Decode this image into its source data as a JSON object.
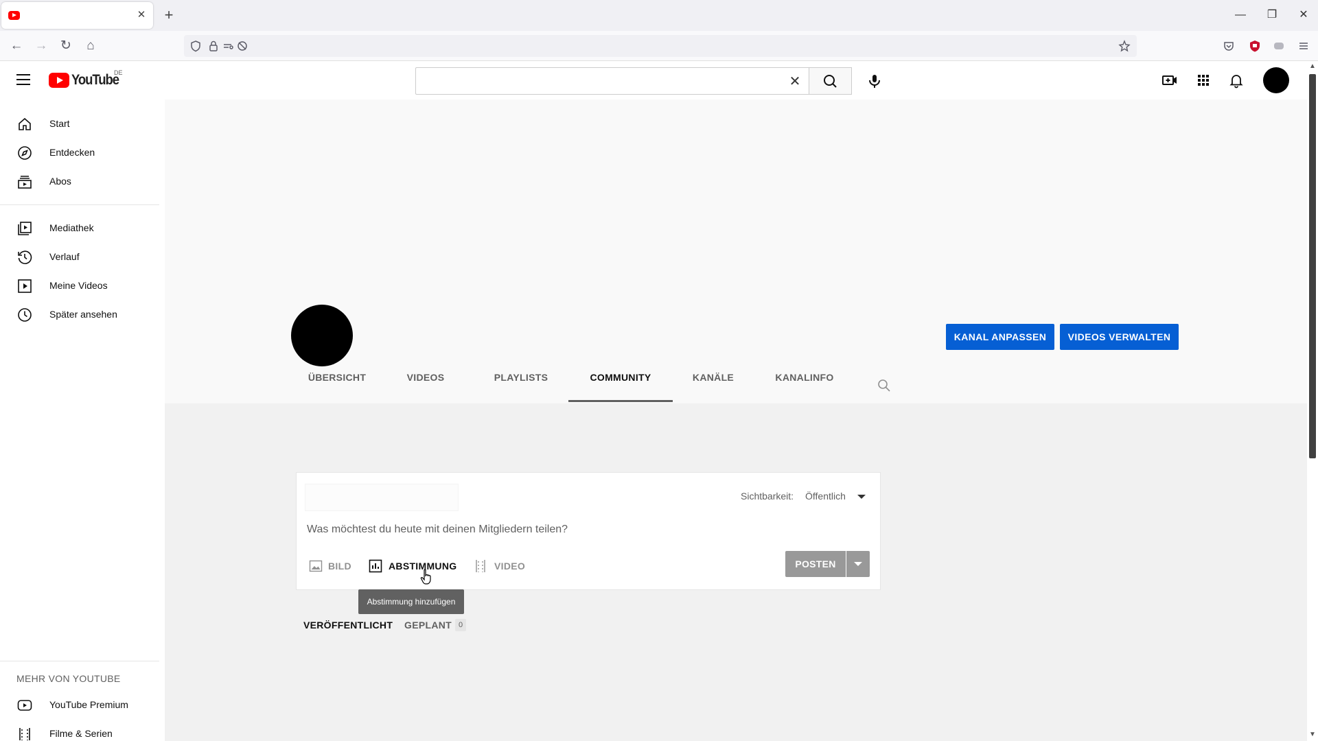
{
  "browser": {
    "tab_title": "",
    "tab_close_glyph": "✕",
    "newtab_glyph": "+",
    "window_controls": {
      "minimize": "—",
      "restore": "❐",
      "close": "✕"
    },
    "nav": {
      "back": "←",
      "forward": "→",
      "reload": "↻",
      "home": "⌂"
    },
    "url_icons": [
      "shield-icon",
      "lock-icon",
      "permissions-icon",
      "tracking-off-icon"
    ]
  },
  "masthead": {
    "logo_text": "YouTube",
    "region_code": "DE",
    "search_placeholder": "",
    "search_value": "",
    "clear_glyph": "✕"
  },
  "sidebar": {
    "primary": [
      {
        "label": "Start",
        "icon": "home-icon"
      },
      {
        "label": "Entdecken",
        "icon": "compass-icon"
      },
      {
        "label": "Abos",
        "icon": "subscriptions-icon"
      }
    ],
    "library": [
      {
        "label": "Mediathek",
        "icon": "library-icon"
      },
      {
        "label": "Verlauf",
        "icon": "history-icon"
      },
      {
        "label": "Meine Videos",
        "icon": "my-videos-icon"
      },
      {
        "label": "Später ansehen",
        "icon": "watch-later-icon"
      }
    ],
    "more_heading": "MEHR VON YOUTUBE",
    "more": [
      {
        "label": "YouTube Premium",
        "icon": "premium-icon"
      },
      {
        "label": "Filme & Serien",
        "icon": "movies-icon"
      }
    ]
  },
  "channel": {
    "customize_button": "KANAL ANPASSEN",
    "manage_button": "VIDEOS VERWALTEN",
    "tabs": [
      "ÜBERSICHT",
      "VIDEOS",
      "PLAYLISTS",
      "COMMUNITY",
      "KANÄLE",
      "KANALINFO"
    ],
    "active_tab": "COMMUNITY"
  },
  "post": {
    "visibility_label": "Sichtbarkeit:",
    "visibility_value": "Öffentlich",
    "prompt": "Was möchtest du heute mit deinen Mitgliedern teilen?",
    "options": {
      "image": "BILD",
      "poll": "ABSTIMMUNG",
      "video": "VIDEO"
    },
    "post_button": "POSTEN",
    "tooltip": "Abstimmung hinzufügen"
  },
  "subtabs": {
    "published": "VERÖFFENTLICHT",
    "scheduled": "GEPLANT",
    "scheduled_count": "0"
  },
  "colors": {
    "brand_red": "#ff0000",
    "primary_blue": "#065fd4",
    "disabled_button": "#999999"
  }
}
